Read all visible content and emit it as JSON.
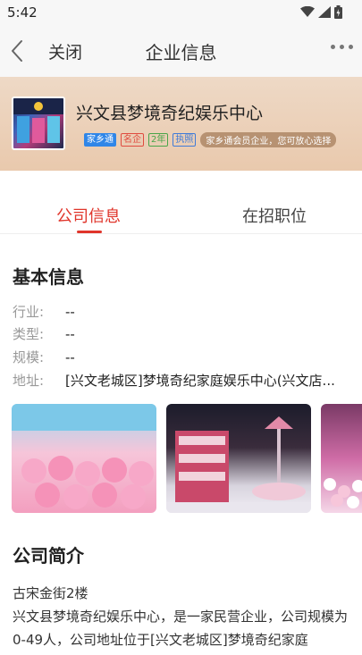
{
  "status_bar": {
    "time": "5:42"
  },
  "nav": {
    "close_label": "关闭",
    "title": "企业信息"
  },
  "company": {
    "name": "兴文县梦境奇纪娱乐中心",
    "badges": [
      "家乡通",
      "名企",
      "2年",
      "执照"
    ],
    "member_note": "家乡通会员企业，您可放心选择"
  },
  "tabs": {
    "info": "公司信息",
    "jobs": "在招职位"
  },
  "basic_info": {
    "title": "基本信息",
    "industry": {
      "label": "行业:",
      "value": "--"
    },
    "type": {
      "label": "类型:",
      "value": "--"
    },
    "scale": {
      "label": "规模:",
      "value": "--"
    },
    "address": {
      "label": "地址:",
      "value": "[兴文老城区]梦境奇纪家庭娱乐中心(兴文店..."
    }
  },
  "intro": {
    "title": "公司简介",
    "line1": "古宋金街2楼",
    "body": "兴文县梦境奇纪娱乐中心，是一家民营企业，公司规模为0-49人，公司地址位于[兴文老城区]梦境奇纪家庭"
  },
  "colors": {
    "accent": "#e0352b",
    "header_bg": "#e9c9ad",
    "badge_blue": "#2f86e8"
  }
}
